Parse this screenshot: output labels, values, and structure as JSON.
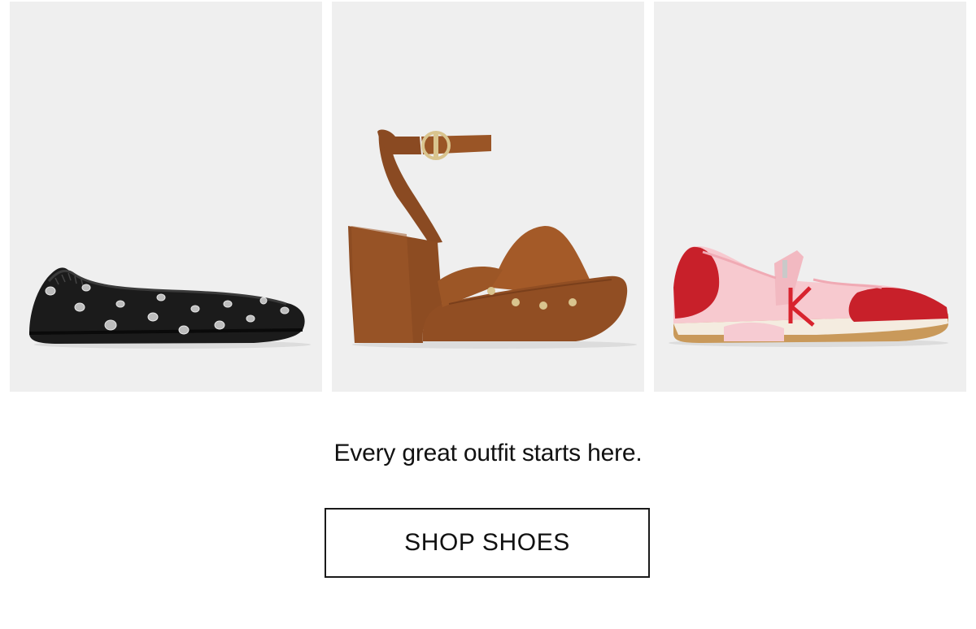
{
  "products": [
    {
      "image_label": "black studded ballet flat"
    },
    {
      "image_label": "brown suede platform sandal with ankle strap"
    },
    {
      "image_label": "pink and red mary jane sneaker"
    }
  ],
  "tagline": "Every great outfit starts here.",
  "cta": {
    "label": "SHOP SHOES"
  },
  "colors": {
    "tile_background": "#efefef",
    "text": "#111111",
    "button_border": "#1a1a1a"
  }
}
